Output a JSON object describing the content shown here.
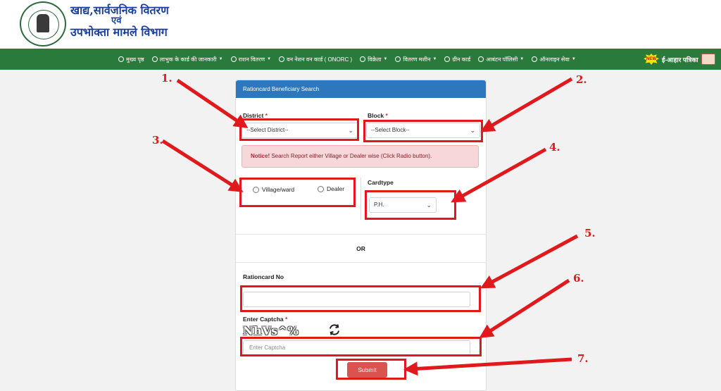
{
  "header": {
    "title_line1": "खाद्य,सार्वजनिक वितरण",
    "title_line2": "एवं",
    "title_line3": "उपभोक्ता मामले विभाग"
  },
  "nav": {
    "items": [
      {
        "label": "मुख्य पृष्ठ",
        "icon": "home-icon",
        "dropdown": false
      },
      {
        "label": "लाभुक के कार्ड की जानकारी",
        "icon": "card-icon",
        "dropdown": true
      },
      {
        "label": "राशन वितरण",
        "icon": "list-icon",
        "dropdown": true
      },
      {
        "label": "वन नेशन वन कार्ड ( ONORC )",
        "icon": "gear-icon",
        "dropdown": false
      },
      {
        "label": "विक्रेता",
        "icon": "user-icon",
        "dropdown": true
      },
      {
        "label": "वितरण मशीन",
        "icon": "machine-icon",
        "dropdown": true
      },
      {
        "label": "ग्रीन कार्ड",
        "icon": "handshake-icon",
        "dropdown": false
      },
      {
        "label": "आबंटन पॉलिसी",
        "icon": "document-icon",
        "dropdown": true
      },
      {
        "label": "ऑनलाइन सेवा",
        "icon": "globe-icon",
        "dropdown": true
      }
    ],
    "eahar_label": "ई-आहार पत्रिका",
    "new_badge": "NEW"
  },
  "form": {
    "header": "Rationcard Beneficiary Search",
    "district_label": "District",
    "district_value": "--Select District--",
    "block_label": "Block",
    "block_value": "--Select Block--",
    "required_mark": "*",
    "notice_strong": "Notice!",
    "notice_text": " Search Report either Village or Dealer wise (Click Radio button).",
    "radio_village": "Village/ward",
    "radio_dealer": "Dealer",
    "cardtype_label": "Cardtype",
    "cardtype_value": "P.H.",
    "or_label": "OR",
    "rationcard_label": "Rationcard No",
    "rationcard_value": "",
    "captcha_label": "Enter Captcha",
    "captcha_text": "NhVs^%",
    "captcha_placeholder": "Enter Captcha",
    "submit_label": "Submit"
  },
  "annotations": {
    "numbers": [
      "1.",
      "2.",
      "3.",
      "4.",
      "5.",
      "6.",
      "7."
    ],
    "color": "#e2191c"
  },
  "colors": {
    "nav_green": "#2a7a3b",
    "card_header_blue": "#2f77bd",
    "submit_red": "#d9534f",
    "brand_blue": "#1a3f9c"
  }
}
